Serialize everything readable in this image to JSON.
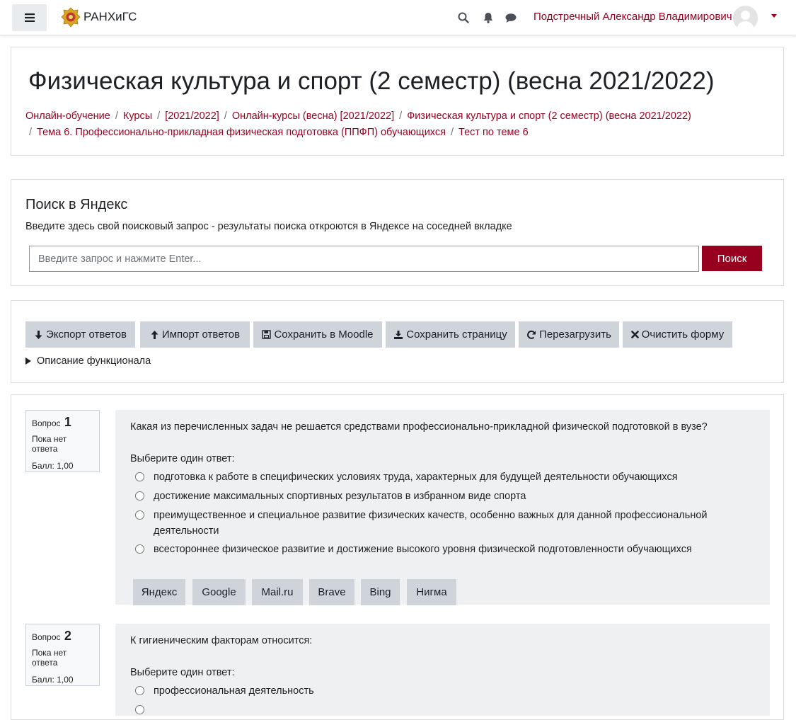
{
  "nav": {
    "brand": "РАНХиГС",
    "user_name": "Подстречный Александр Владимирович"
  },
  "header": {
    "title": "Физическая культура и спорт (2 семестр) (весна 2021/2022)",
    "breadcrumbs": [
      "Онлайн-обучение",
      "Курсы",
      "[2021/2022]",
      "Онлайн-курсы (весна) [2021/2022]",
      "Физическая культура и спорт (2 семестр) (весна 2021/2022)",
      "Тема 6. Профессионально-прикладная физическая подготовка (ППФП) обучающихся",
      "Тест по теме 6"
    ]
  },
  "search": {
    "title": "Поиск в Яндекс",
    "description": "Введите здесь свой поисковый запрос - результаты поиска откроются в Яндексе на соседней вкладке",
    "placeholder": "Введите запрос и нажмите Enter...",
    "button": "Поиск"
  },
  "tools": {
    "buttons": [
      {
        "label": "Экспорт ответов",
        "icon": "arrow-down-icon"
      },
      {
        "label": "Импорт ответов",
        "icon": "arrow-up-icon"
      },
      {
        "label": "Сохранить в Moodle",
        "icon": "floppy-icon"
      },
      {
        "label": "Сохранить страницу",
        "icon": "download-icon"
      },
      {
        "label": "Перезагрузить",
        "icon": "refresh-icon"
      },
      {
        "label": "Очистить форму",
        "icon": "close-icon"
      }
    ],
    "details_label": "Описание функционала"
  },
  "questions": [
    {
      "label": "Вопрос",
      "number": "1",
      "state": "Пока нет ответа",
      "grade": "Балл: 1,00",
      "text": "Какая из перечисленных задач не решается средствами профессионально-прикладной физической подготовкой в вузе?",
      "prompt": "Выберите один ответ:",
      "options": [
        "подготовка к работе в специфических условиях труда, характерных для будущей деятельности обучающихся",
        "достижение максимальных спортивных результатов в избранном виде спорта",
        "преимущественное и специальное развитие физических качеств, особенно важных для данной профессиональной деятельности",
        "всестороннее физическое развитие и достижение высокого уровня физической подготовленности обучающихся"
      ],
      "engines": [
        "Яндекс",
        "Google",
        "Mail.ru",
        "Brave",
        "Bing",
        "Нигма"
      ]
    },
    {
      "label": "Вопрос",
      "number": "2",
      "state": "Пока нет ответа",
      "grade": "Балл: 1,00",
      "text": "К гигиеническим факторам относится:",
      "prompt": "Выберите один ответ:",
      "options": [
        "профессиональная деятельность"
      ]
    }
  ],
  "colors": {
    "brand": "#98001f",
    "button_gray": "#ced4da",
    "question_bg": "#eff0f1"
  }
}
